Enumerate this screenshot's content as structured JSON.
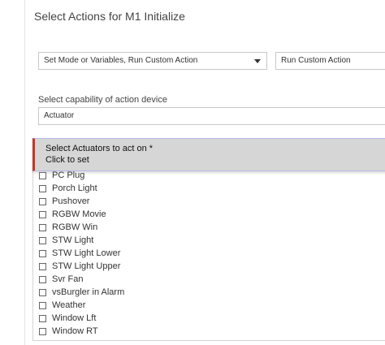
{
  "page": {
    "title": "Select Actions for M1 Initialize"
  },
  "action_type": {
    "selected": "Set Mode or Variables, Run Custom Action",
    "icon": "chevron-down-icon"
  },
  "custom_action": {
    "selected": "Run Custom Action"
  },
  "capability": {
    "label": "Select capability of action device",
    "selected": "Actuator"
  },
  "actuators": {
    "title": "Select Actuators to act on *",
    "hint": "Click to set",
    "accent_color": "#c0392b",
    "items": [
      {
        "label": "PC Plug",
        "checked": false
      },
      {
        "label": "Porch Light",
        "checked": false
      },
      {
        "label": "Pushover",
        "checked": false
      },
      {
        "label": "RGBW Movie",
        "checked": false
      },
      {
        "label": "RGBW Win",
        "checked": false
      },
      {
        "label": "STW Light",
        "checked": false
      },
      {
        "label": "STW Light Lower",
        "checked": false
      },
      {
        "label": "STW Light Upper",
        "checked": false
      },
      {
        "label": "Svr Fan",
        "checked": false
      },
      {
        "label": "vsBurgler in Alarm",
        "checked": false
      },
      {
        "label": "Weather",
        "checked": false
      },
      {
        "label": "Window Lft",
        "checked": false
      },
      {
        "label": "Window RT",
        "checked": false
      }
    ]
  }
}
